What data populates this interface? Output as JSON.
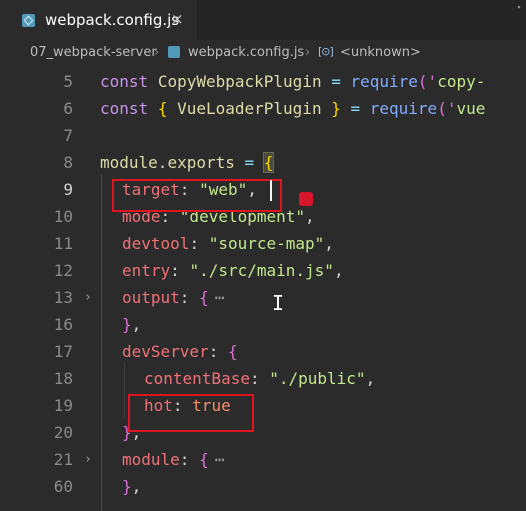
{
  "tab": {
    "filename": "webpack.config.js",
    "close": "×"
  },
  "breadcrumb": {
    "folder": "07_webpack-server",
    "sep": "›",
    "file": "webpack.config.js",
    "symbol_icon": "[⊙]",
    "symbol": "<unknown>"
  },
  "editor": {
    "line_numbers": [
      "5",
      "6",
      "7",
      "8",
      "9",
      "10",
      "11",
      "12",
      "13",
      "16",
      "17",
      "18",
      "19",
      "20",
      "21",
      "60"
    ],
    "active_line": "9",
    "code": {
      "l5": {
        "kw": "const",
        "name": "CopyWebpackPlugin",
        "eq": " = ",
        "fn": "require",
        "open": "('",
        "str": "copy-"
      },
      "l6": {
        "kw": "const",
        "lb": "{ ",
        "name": "VueLoaderPlugin",
        "rb": " }",
        "eq": " = ",
        "fn": "require",
        "open": "('",
        "str": "vue"
      },
      "l8": {
        "obj": "module",
        "dot": ".",
        "prop": "exports",
        "eq": " = ",
        "brace": "{"
      },
      "l9": {
        "key": "target",
        "colon": ": ",
        "val": "\"web\"",
        "comma": ","
      },
      "l10": {
        "key": "mode",
        "colon": ": ",
        "val": "\"development\"",
        "comma": ","
      },
      "l11": {
        "key": "devtool",
        "colon": ": ",
        "val": "\"source-map\"",
        "comma": ","
      },
      "l12": {
        "key": "entry",
        "colon": ": ",
        "val": "\"./src/main.js\"",
        "comma": ","
      },
      "l13": {
        "key": "output",
        "colon": ": ",
        "brace": "{",
        "ellipsis": "⋯"
      },
      "l16": {
        "brace": "}",
        "comma": ","
      },
      "l17": {
        "key": "devServer",
        "colon": ": ",
        "brace": "{"
      },
      "l18": {
        "key": "contentBase",
        "colon": ": ",
        "val": "\"./public\"",
        "comma": ","
      },
      "l19": {
        "key": "hot",
        "colon": ": ",
        "val": "true"
      },
      "l20": {
        "brace": "}",
        "comma": ","
      },
      "l21": {
        "key": "module",
        "colon": ": ",
        "brace": "{",
        "ellipsis": "⋯"
      },
      "l60": {
        "brace": "}",
        "comma": ","
      }
    },
    "fold_icon": "›",
    "ibeam": "I"
  }
}
